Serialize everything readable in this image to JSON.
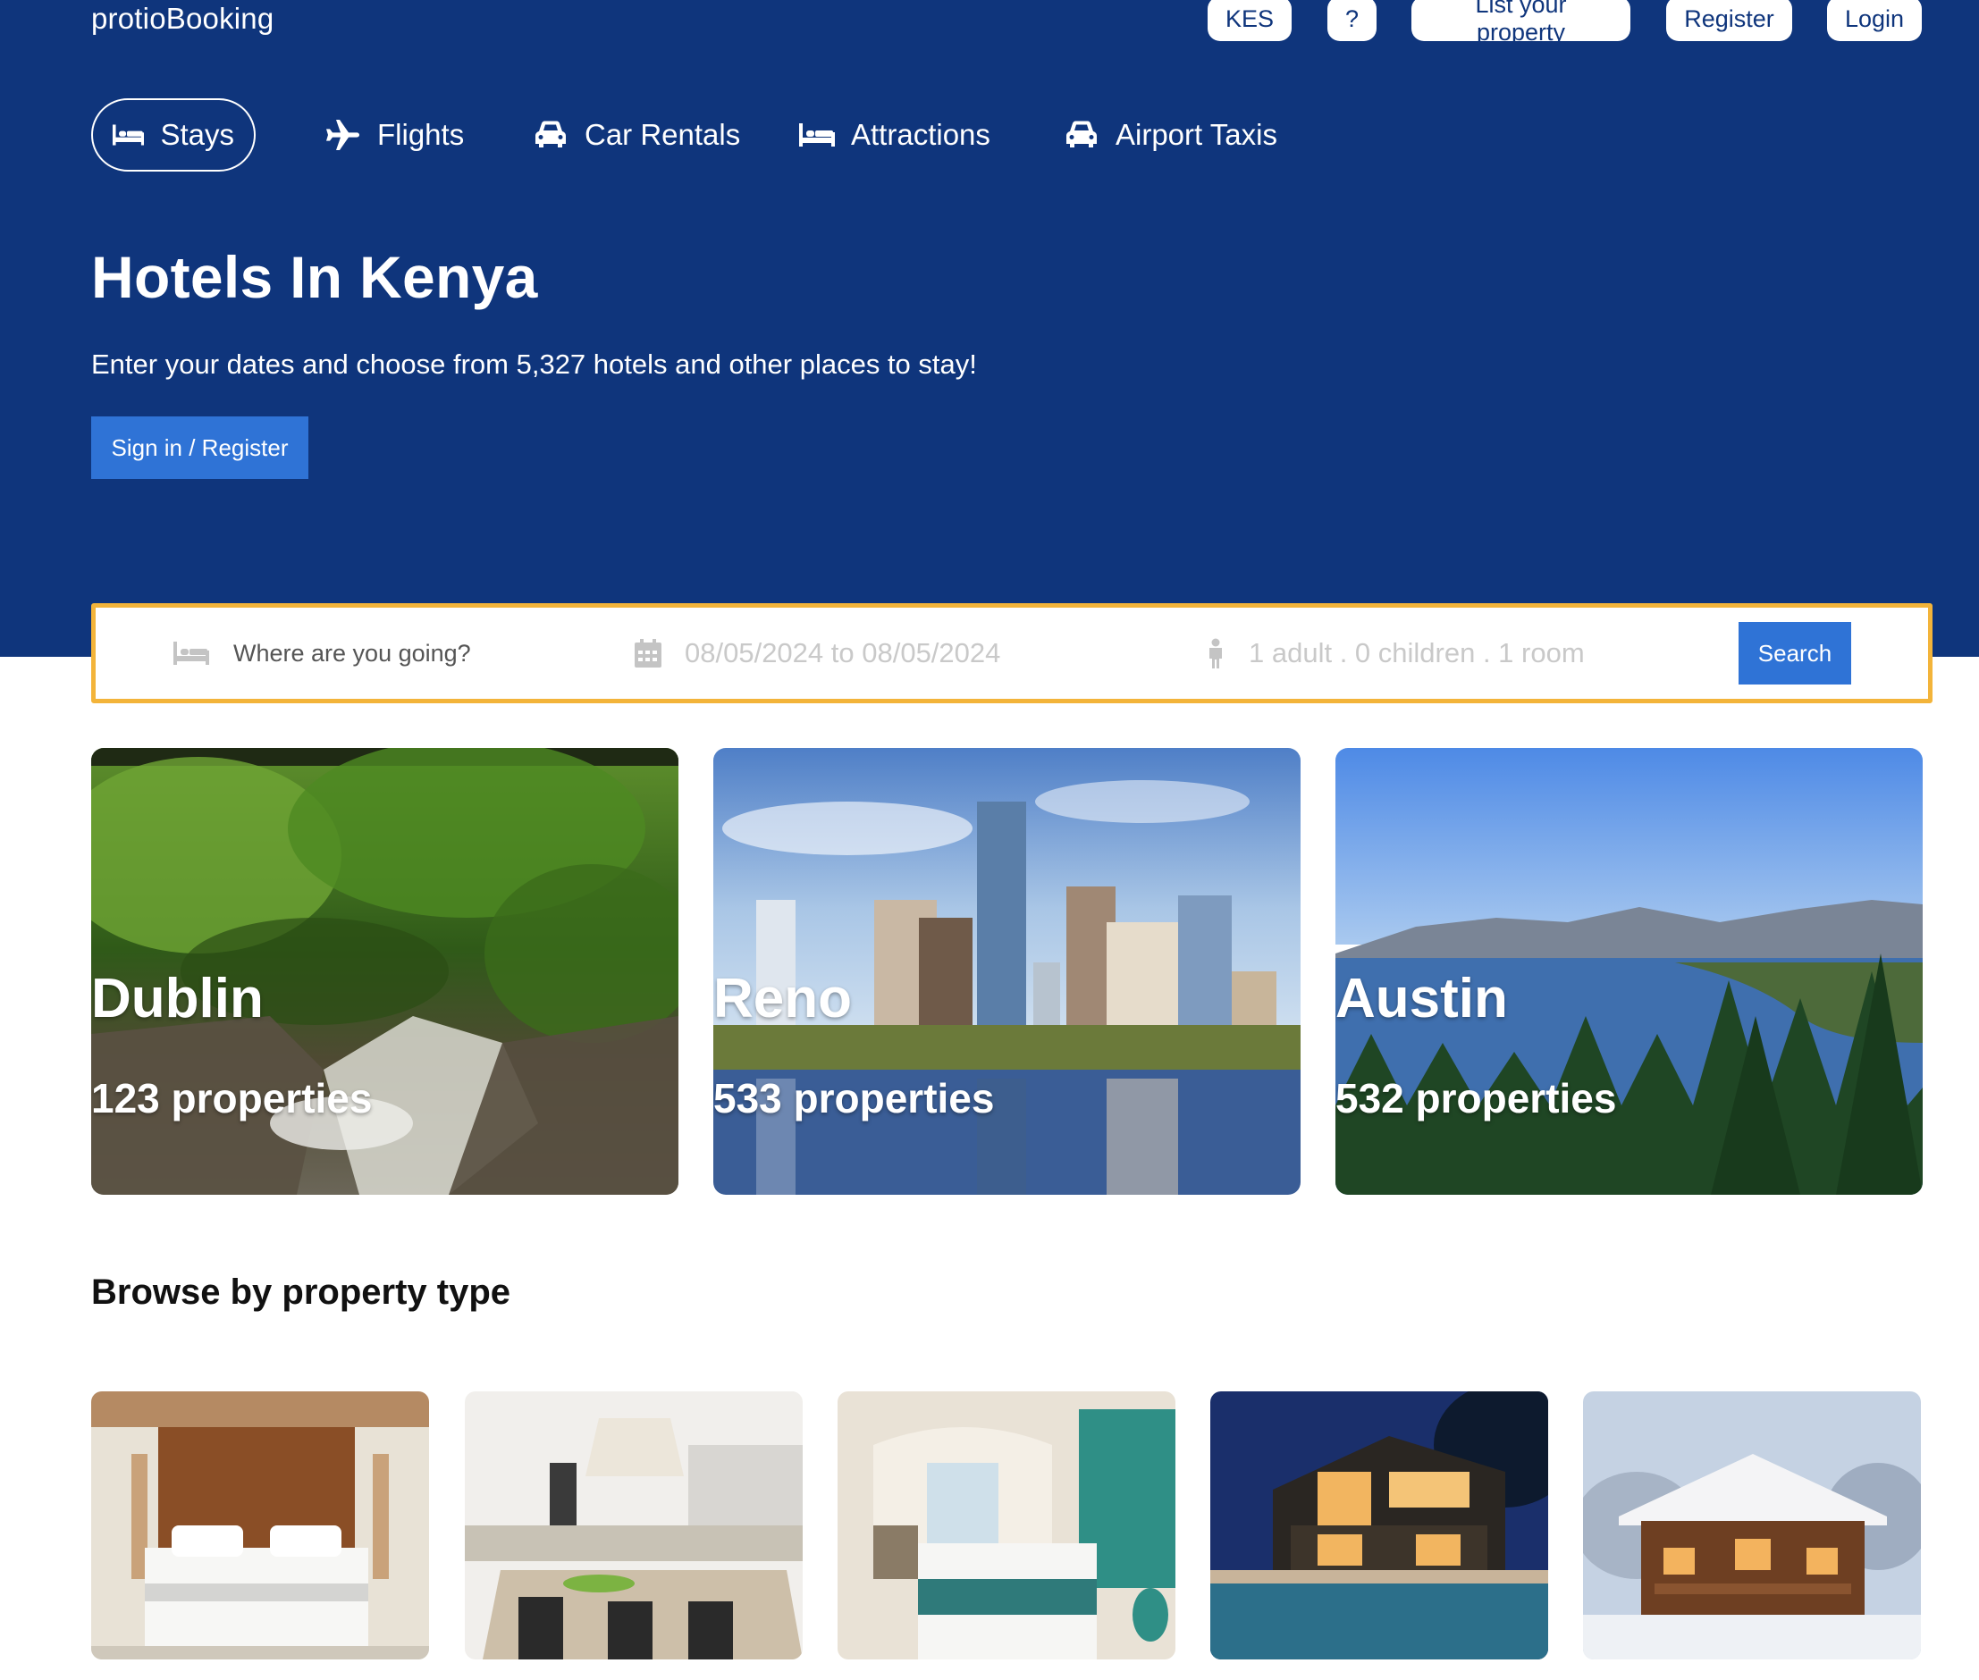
{
  "header": {
    "logo": "protioBooking",
    "buttons": {
      "currency": "KES",
      "help": "?",
      "list_property": "List your property",
      "register": "Register",
      "login": "Login"
    }
  },
  "nav": {
    "items": [
      {
        "label": "Stays",
        "icon": "bed-icon",
        "active": true
      },
      {
        "label": "Flights",
        "icon": "plane-icon",
        "active": false
      },
      {
        "label": "Car Rentals",
        "icon": "car-icon",
        "active": false
      },
      {
        "label": "Attractions",
        "icon": "bed-icon",
        "active": false
      },
      {
        "label": "Airport Taxis",
        "icon": "taxi-icon",
        "active": false
      }
    ]
  },
  "hero": {
    "title": "Hotels In Kenya",
    "subtitle": "Enter your dates and choose from 5,327 hotels and other places to stay!",
    "signin_label": "Sign in / Register"
  },
  "search": {
    "destination_placeholder": "Where are you going?",
    "dates": "08/05/2024 to 08/05/2024",
    "guests": "1 adult . 0 children . 1 room",
    "button_label": "Search"
  },
  "featured": [
    {
      "city": "Dublin",
      "count": "123 properties"
    },
    {
      "city": "Reno",
      "count": "533 properties"
    },
    {
      "city": "Austin",
      "count": "532 properties"
    }
  ],
  "browse": {
    "title": "Browse by property type"
  },
  "colors": {
    "brand_blue": "#0f357c",
    "accent_blue": "#2f73d6",
    "search_border": "#f3b43a"
  }
}
